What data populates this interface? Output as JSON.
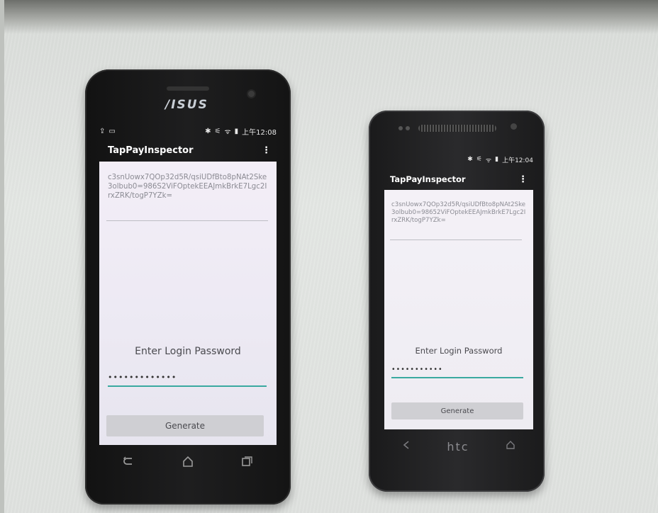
{
  "asus": {
    "brand": "/ISUS",
    "status_left": [
      "⇪",
      "▭"
    ],
    "status_right": [
      "✱",
      "⚟",
      "ᯤ",
      "▮",
      "上午12:08"
    ],
    "app_title": "TapPayInspector",
    "menu_icon": "⋮",
    "hash": "c3snUowx7QOp32d5R/qsiUDfBto8pNAt2Ske3olbub0=986S2ViFOptekEEAJmkBrkE7Lgc2IrxZRK/togP7YZk=",
    "prompt": "Enter Login Password",
    "password": "•••••••••••••",
    "generate_label": "Generate",
    "nav_icons": [
      "back-icon",
      "home-icon",
      "recents-icon"
    ]
  },
  "htc": {
    "status_right": [
      "✱",
      "⚟",
      "ᯤ",
      "▮",
      "上午12:04"
    ],
    "app_title": "TapPayInspector",
    "menu_icon": "⋮",
    "hash": "c3snUowx7QOp32d5R/qsiUDfBto8pNAt2Ske3olbub0=98652ViFOptekEEAJmkBrkE7Lgc2IrxZRK/togP7YZk=",
    "prompt": "Enter Login Password",
    "password": "•••••••••••",
    "generate_label": "Generate",
    "brand": "htc"
  }
}
